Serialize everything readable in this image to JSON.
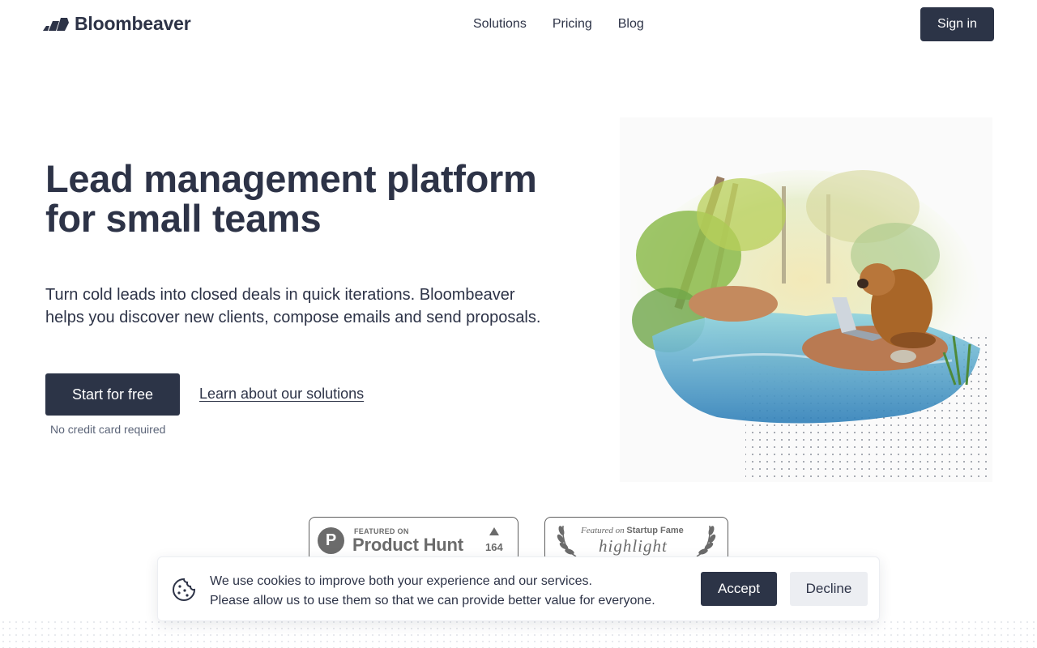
{
  "brand": {
    "name": "Bloombeaver",
    "logo_icon": "bloombeaver-logo-icon"
  },
  "nav": {
    "items": [
      "Solutions",
      "Pricing",
      "Blog"
    ],
    "sign_in": "Sign in"
  },
  "hero": {
    "title_line1": "Lead management platform",
    "title_line2": "for small teams",
    "subtitle_line1": "Turn cold leads into closed deals in quick iterations. Bloombeaver",
    "subtitle_line2": "helps you discover new clients, compose emails and send proposals.",
    "cta_primary": "Start for free",
    "cta_secondary": "Learn about our solutions",
    "cta_note": "No credit card required",
    "illustration": "watercolor-beaver-with-laptop-by-river"
  },
  "badges": {
    "product_hunt": {
      "featured": "FEATURED ON",
      "name": "Product Hunt",
      "votes": "164",
      "icon": "product-hunt-icon"
    },
    "startup_fame": {
      "featured_prefix": "Featured on",
      "brand": "Startup Fame",
      "label": "highlight",
      "icon": "laurel-icon"
    }
  },
  "cookie_banner": {
    "line1": "We use cookies to improve both your experience and our services.",
    "line2": "Please allow us to use them so that we can provide better value for everyone.",
    "accept": "Accept",
    "decline": "Decline",
    "icon": "cookie-icon"
  },
  "colors": {
    "primary": "#2c3447",
    "text": "#2d3347",
    "muted": "#5b6478",
    "badge_gray": "#6b6b6b"
  }
}
